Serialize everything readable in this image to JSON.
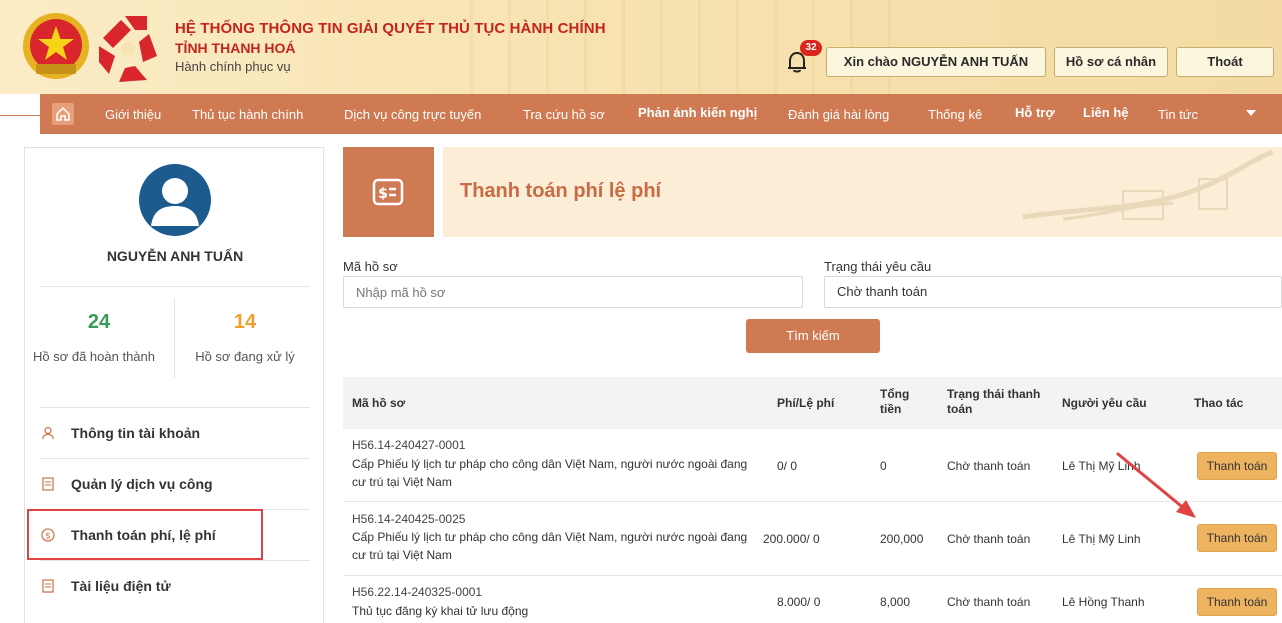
{
  "header": {
    "title_line1": "HỆ THỐNG THÔNG TIN GIẢI QUYẾT THỦ TỤC HÀNH CHÍNH",
    "title_line2": "TỈNH THANH HOÁ",
    "title_line3": "Hành chính phục vụ",
    "notification_count": "32",
    "greeting": "Xin chào NGUYỄN ANH TUẤN",
    "profile_label": "Hồ sơ cá nhân",
    "logout_label": "Thoát"
  },
  "nav": {
    "items": [
      "Giới thiệu",
      "Thủ tục hành chính",
      "Dịch vụ công trực tuyến",
      "Tra cứu hồ sơ",
      "Phản ánh kiến nghị",
      "Đánh giá hài lòng",
      "Thống kê",
      "Hỗ trợ",
      "Liên hệ",
      "Tin tức"
    ]
  },
  "sidebar": {
    "user_name": "NGUYỄN ANH TUẤN",
    "completed_count": "24",
    "completed_label": "Hồ sơ đã hoàn thành",
    "processing_count": "14",
    "processing_label": "Hồ sơ đang xử lý",
    "menu": [
      "Thông tin tài khoản",
      "Quản lý dịch vụ công",
      "Thanh toán phí, lệ phí",
      "Tài liệu điện tử"
    ]
  },
  "page": {
    "title": "Thanh toán phí lệ phí"
  },
  "filters": {
    "code_label": "Mã hồ sơ",
    "code_placeholder": "Nhập mã hồ sơ",
    "status_label": "Trạng thái yêu cầu",
    "status_value": "Chờ thanh toán",
    "search_label": "Tìm kiếm"
  },
  "table": {
    "headers": {
      "code": "Mã hồ sơ",
      "fee": "Phí/Lệ phí",
      "total_l1": "Tổng",
      "total_l2": "tiền",
      "status_l1": "Trạng thái thanh",
      "status_l2": "toán",
      "requester": "Người yêu cầu",
      "action": "Thao tác"
    },
    "rows": [
      {
        "code": "H56.14-240427-0001",
        "desc1": "Cấp Phiếu lý lịch tư pháp cho công dân Việt Nam, người nước ngoài đang",
        "desc2": "cư trú tại Việt Nam",
        "fee": "0/ 0",
        "total": "0",
        "status": "Chờ thanh toán",
        "requester": "Lê Thị Mỹ Linh",
        "action": "Thanh toán"
      },
      {
        "code": "H56.14-240425-0025",
        "desc1": "Cấp Phiếu lý lịch tư pháp cho công dân Việt Nam, người nước ngoài đang",
        "desc2": "cư trú tại Việt Nam",
        "fee": "200.000/ 0",
        "total": "200,000",
        "status": "Chờ thanh toán",
        "requester": "Lê Thị Mỹ Linh",
        "action": "Thanh toán"
      },
      {
        "code": "H56.22.14-240325-0001",
        "desc1": "Thủ tục đăng ký khai tử lưu động",
        "desc2": "",
        "fee": "8.000/ 0",
        "total": "8,000",
        "status": "Chờ thanh toán",
        "requester": "Lê Hồng Thanh",
        "action": "Thanh toán"
      }
    ]
  },
  "colors": {
    "accent": "#cf7a52",
    "title_red": "#c3241c",
    "completed_green": "#3a9a5b",
    "processing_orange": "#f0a030",
    "pay_button": "#edb35f",
    "highlight_red": "#e04343"
  }
}
